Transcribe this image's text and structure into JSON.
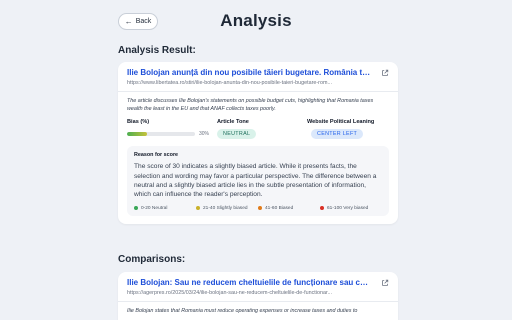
{
  "header": {
    "back_label": "Back",
    "title": "Analysis"
  },
  "analysis": {
    "section_title": "Analysis Result:",
    "article": {
      "title": "Ilie Bolojan anunță din nou posibile tăieri bugetare. România taxează b...",
      "url": "https://www.libertatea.ro/stiri/ilie-bolojan-anunta-din-nou-posibile-taieri-bugetare-rom...",
      "summary": "The article discusses Ilie Bolojan's statements on possible budget cuts, highlighting that Romania taxes wealth the least in the EU and that ANAF collects taxes poorly."
    },
    "bias": {
      "label": "Bias (%)",
      "value": 30,
      "value_text": "30%"
    },
    "tone": {
      "label": "Article Tone",
      "value": "NEUTRAL"
    },
    "leaning": {
      "label": "Website Political Leaning",
      "value": "CENTER LEFT"
    },
    "reason": {
      "label": "Reason for score",
      "text": "The score of 30 indicates a slightly biased article. While it presents facts, the selection and wording may favor a particular perspective. The difference between a neutral and a slightly biased article lies in the subtle presentation of information, which can influence the reader's perception."
    },
    "legend": [
      {
        "label": "0-20 Neutral",
        "color": "#3aa757"
      },
      {
        "label": "21-40 Slightly biased",
        "color": "#c9b12b"
      },
      {
        "label": "41-60 Biased",
        "color": "#e07b1a"
      },
      {
        "label": "61-100 Very biased",
        "color": "#d93025"
      }
    ]
  },
  "comparisons": {
    "section_title": "Comparisons:",
    "article": {
      "title": "Ilie Bolojan: Sau ne reducem cheltuielile de funcționare sau creștem ta...",
      "url": "https://agerpres.ro/2025/03/24/ilie-bolojan-sau-ne-reducem-cheltuielile-de-functionar...",
      "summary": "Ilie Bolojan states that Romania must reduce operating expenses or increase taxes and duties to"
    }
  },
  "colors": {
    "link": "#1d4ed8",
    "neutral_pill_bg": "#d9f2ea",
    "center_left_pill_bg": "#dbe8fb"
  }
}
